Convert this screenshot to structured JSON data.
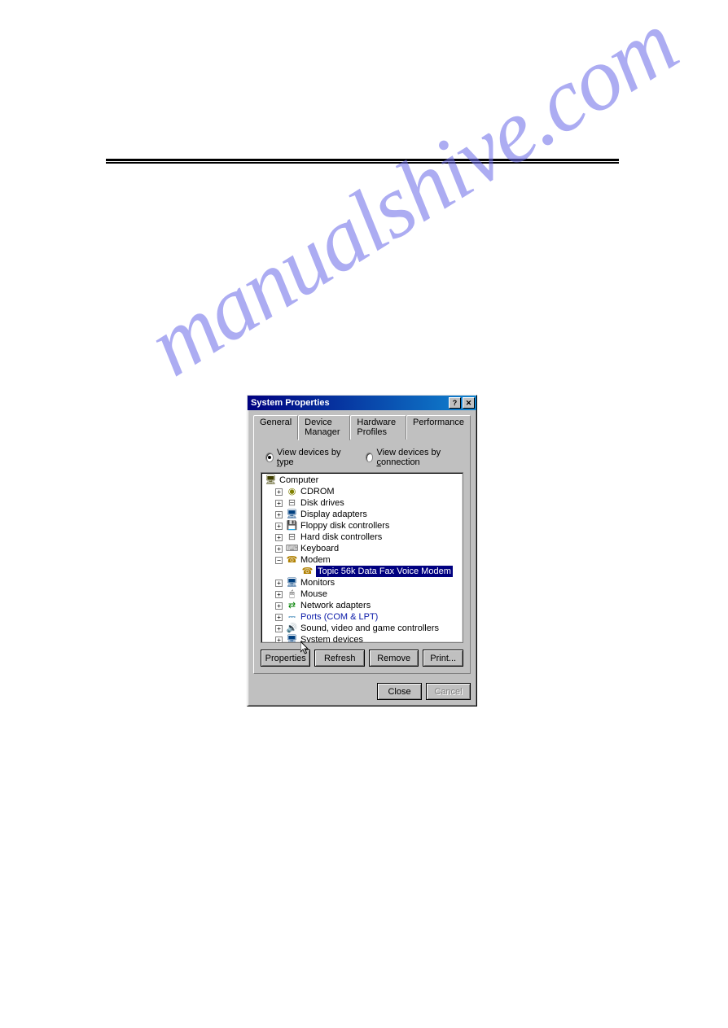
{
  "watermark_text": "manualshive.com",
  "dialog": {
    "title": "System Properties",
    "help_btn": "?",
    "close_btn": "✕",
    "tabs": {
      "general": "General",
      "device_manager": "Device Manager",
      "hardware_profiles": "Hardware Profiles",
      "performance": "Performance"
    },
    "radio": {
      "by_type_prefix": "View devices by ",
      "by_type_u": "t",
      "by_type_suffix": "ype",
      "by_conn_prefix": "View devices by ",
      "by_conn_u": "c",
      "by_conn_suffix": "onnection"
    },
    "tree": {
      "root": "Computer",
      "items": [
        {
          "exp": "+",
          "icon": "icon-disc",
          "glyph": "◉",
          "label": "CDROM"
        },
        {
          "exp": "+",
          "icon": "icon-disk",
          "glyph": "⊟",
          "label": "Disk drives"
        },
        {
          "exp": "+",
          "icon": "icon-display",
          "glyph": "🖥",
          "label": "Display adapters"
        },
        {
          "exp": "+",
          "icon": "icon-floppy",
          "glyph": "💾",
          "label": "Floppy disk controllers"
        },
        {
          "exp": "+",
          "icon": "icon-hdd",
          "glyph": "⊟",
          "label": "Hard disk controllers"
        },
        {
          "exp": "+",
          "icon": "icon-keyboard",
          "glyph": "⌨",
          "label": "Keyboard"
        },
        {
          "exp": "−",
          "icon": "icon-modem",
          "glyph": "☎",
          "label": "Modem",
          "children": [
            {
              "icon": "icon-modem",
              "glyph": "☎",
              "label": "Topic 56k Data Fax Voice Modem",
              "selected": true
            }
          ]
        },
        {
          "exp": "+",
          "icon": "icon-monitor",
          "glyph": "🖥",
          "label": "Monitors"
        },
        {
          "exp": "+",
          "icon": "icon-mouse",
          "glyph": "🖱",
          "label": "Mouse"
        },
        {
          "exp": "+",
          "icon": "icon-network",
          "glyph": "⇄",
          "label": "Network adapters"
        },
        {
          "exp": "+",
          "icon": "icon-ports",
          "glyph": "⎓",
          "label": "Ports (COM & LPT)",
          "link": true
        },
        {
          "exp": "+",
          "icon": "icon-sound",
          "glyph": "🔊",
          "label": "Sound, video and game controllers"
        },
        {
          "exp": "+",
          "icon": "icon-system",
          "glyph": "🖥",
          "label": "System devices"
        }
      ]
    },
    "buttons": {
      "properties": "Properties",
      "refresh": "Refresh",
      "remove": "Remove",
      "print": "Print...",
      "close": "Close",
      "cancel": "Cancel"
    }
  }
}
